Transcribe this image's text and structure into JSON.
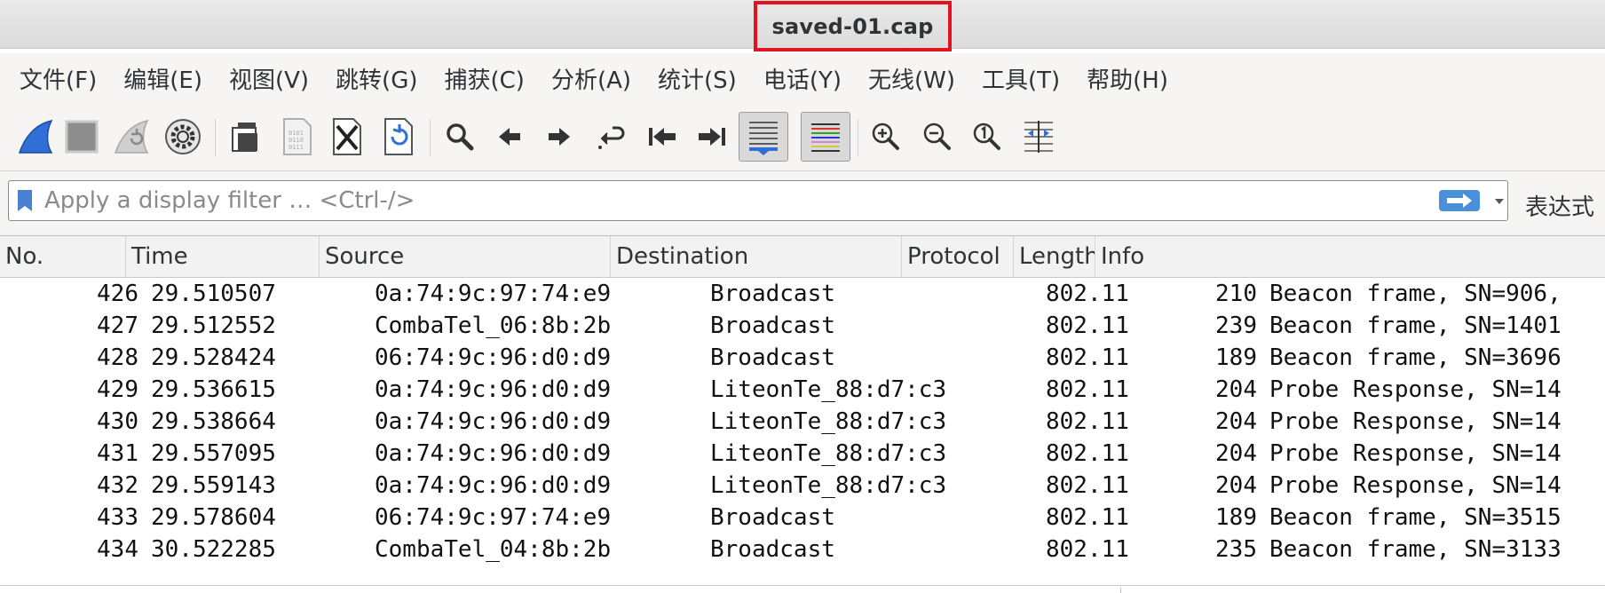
{
  "window": {
    "title": "saved-01.cap"
  },
  "menu": [
    "文件(F)",
    "编辑(E)",
    "视图(V)",
    "跳转(G)",
    "捕获(C)",
    "分析(A)",
    "统计(S)",
    "电话(Y)",
    "无线(W)",
    "工具(T)",
    "帮助(H)"
  ],
  "toolbar": {
    "buttons": [
      "start-capture",
      "stop-capture",
      "restart-capture",
      "capture-options",
      "open-file",
      "save-file",
      "close-file",
      "reload-file",
      "find-packet",
      "go-back",
      "go-forward",
      "go-to-packet",
      "go-first",
      "go-last",
      "auto-scroll",
      "colorize",
      "zoom-in",
      "zoom-out",
      "normal-size",
      "resize-columns"
    ]
  },
  "filter": {
    "placeholder": "Apply a display filter … <Ctrl-/>",
    "value": "",
    "expression_label": "表达式"
  },
  "colors": {
    "highlight_border": "#e0141e",
    "apply_arrow": "#4a90d9",
    "bookmark": "#4a7fd1"
  },
  "packet_list": {
    "columns": [
      "No.",
      "Time",
      "Source",
      "Destination",
      "Protocol",
      "Length",
      "Info"
    ],
    "rows": [
      {
        "no": "426",
        "time": "29.510507",
        "source": "0a:74:9c:97:74:e9",
        "destination": "Broadcast",
        "protocol": "802.11",
        "length": "210",
        "info": "Beacon frame, SN=906,"
      },
      {
        "no": "427",
        "time": "29.512552",
        "source": "CombaTel_06:8b:2b",
        "destination": "Broadcast",
        "protocol": "802.11",
        "length": "239",
        "info": "Beacon frame, SN=1401"
      },
      {
        "no": "428",
        "time": "29.528424",
        "source": "06:74:9c:96:d0:d9",
        "destination": "Broadcast",
        "protocol": "802.11",
        "length": "189",
        "info": "Beacon frame, SN=3696"
      },
      {
        "no": "429",
        "time": "29.536615",
        "source": "0a:74:9c:96:d0:d9",
        "destination": "LiteonTe_88:d7:c3",
        "protocol": "802.11",
        "length": "204",
        "info": "Probe Response, SN=14"
      },
      {
        "no": "430",
        "time": "29.538664",
        "source": "0a:74:9c:96:d0:d9",
        "destination": "LiteonTe_88:d7:c3",
        "protocol": "802.11",
        "length": "204",
        "info": "Probe Response, SN=14"
      },
      {
        "no": "431",
        "time": "29.557095",
        "source": "0a:74:9c:96:d0:d9",
        "destination": "LiteonTe_88:d7:c3",
        "protocol": "802.11",
        "length": "204",
        "info": "Probe Response, SN=14"
      },
      {
        "no": "432",
        "time": "29.559143",
        "source": "0a:74:9c:96:d0:d9",
        "destination": "LiteonTe_88:d7:c3",
        "protocol": "802.11",
        "length": "204",
        "info": "Probe Response, SN=14"
      },
      {
        "no": "433",
        "time": "29.578604",
        "source": "06:74:9c:97:74:e9",
        "destination": "Broadcast",
        "protocol": "802.11",
        "length": "189",
        "info": "Beacon frame, SN=3515"
      },
      {
        "no": "434",
        "time": "30.522285",
        "source": "CombaTel_04:8b:2b",
        "destination": "Broadcast",
        "protocol": "802.11",
        "length": "235",
        "info": "Beacon frame, SN=3133"
      }
    ]
  }
}
